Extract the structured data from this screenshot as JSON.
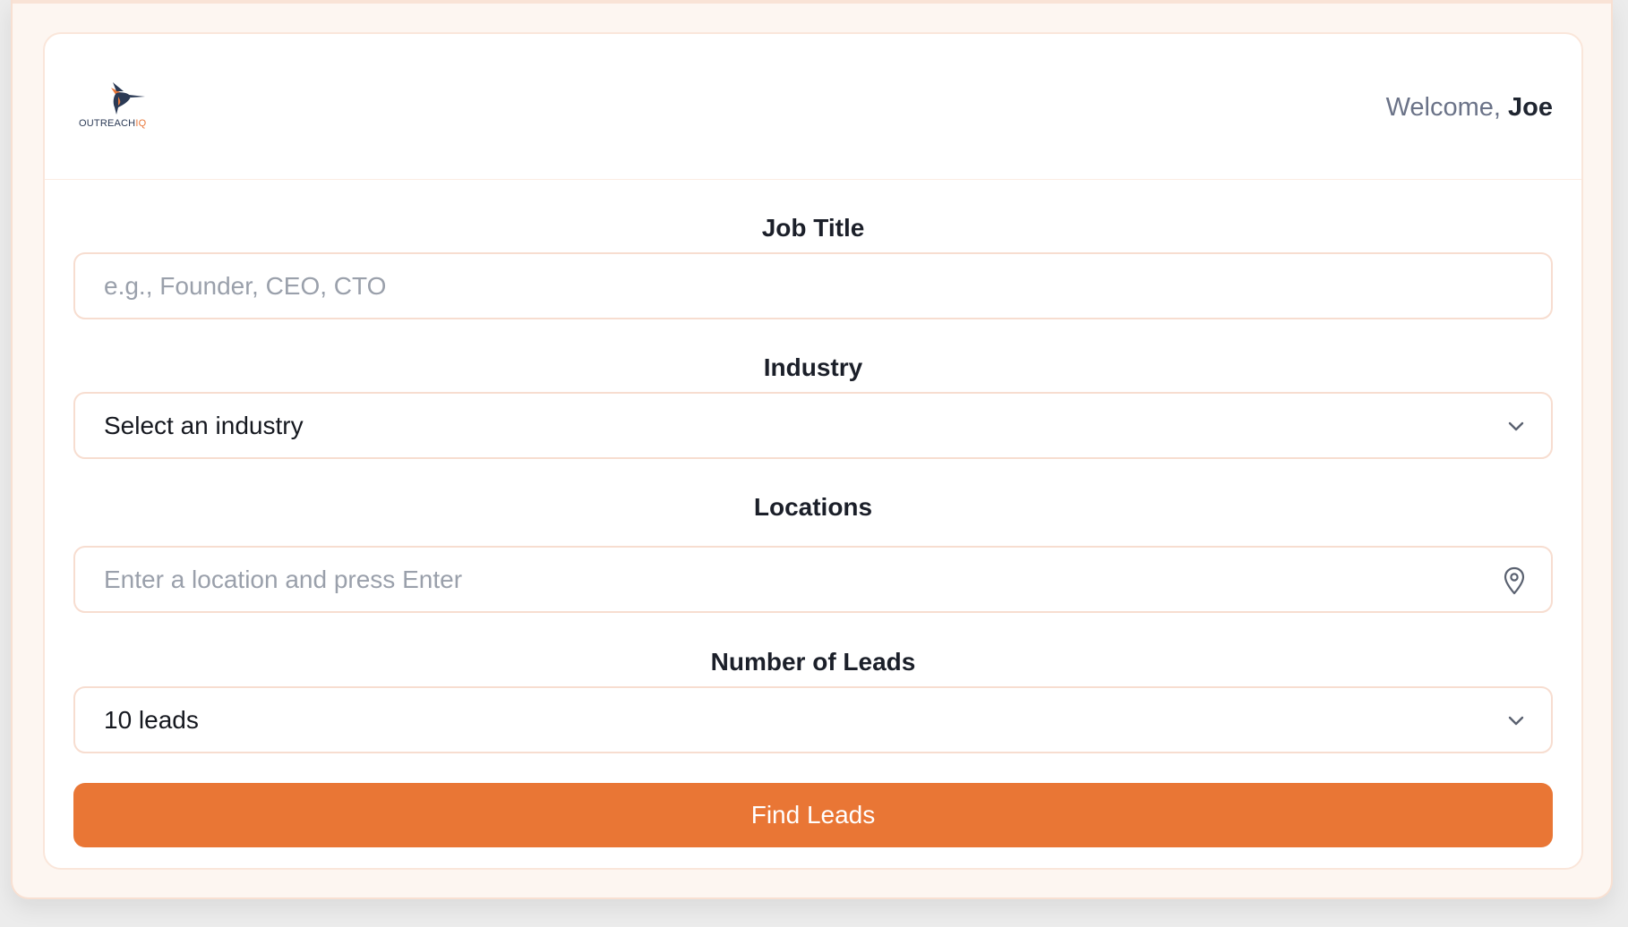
{
  "header": {
    "logo_text": "OUTREACH",
    "logo_text_accent": "IQ",
    "welcome_prefix": "Welcome,",
    "user_name": "Joe"
  },
  "form": {
    "job_title": {
      "label": "Job Title",
      "value": "",
      "placeholder": "e.g., Founder, CEO, CTO"
    },
    "industry": {
      "label": "Industry",
      "selected": "Select an industry",
      "icon": "chevron-down-icon"
    },
    "locations": {
      "label": "Locations",
      "value": "",
      "placeholder": "Enter a location and press Enter",
      "icon": "map-pin-icon"
    },
    "num_leads": {
      "label": "Number of Leads",
      "selected": "10 leads",
      "icon": "chevron-down-icon"
    },
    "submit_label": "Find Leads"
  },
  "colors": {
    "accent": "#e97635",
    "border": "#f7ddd0",
    "background": "#fdf6f1"
  }
}
